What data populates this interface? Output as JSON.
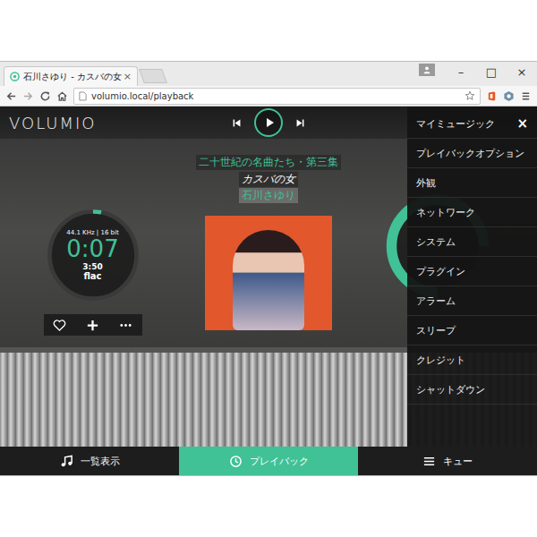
{
  "window": {
    "tab_title": "石川さゆり - カスバの女",
    "tab_close": "×",
    "controls": [
      "–",
      "□",
      "×"
    ]
  },
  "address_bar": {
    "url": "volumio.local/playback"
  },
  "app": {
    "logo": "VOLUMIO"
  },
  "track": {
    "album": "二十世紀の名曲たち・第三集",
    "title": "カスバの女",
    "artist": "石川さゆり",
    "quality": "44.1 KHz | 16 bit",
    "elapsed": "0:07",
    "duration": "3:50",
    "format": "flac",
    "level": 0.03
  },
  "volume": {
    "level": 0.75
  },
  "menu": {
    "close": "×",
    "items": [
      "マイミュージック",
      "プレイバックオプション",
      "外観",
      "ネットワーク",
      "システム",
      "プラグイン",
      "アラーム",
      "スリープ",
      "クレジット",
      "シャットダウン"
    ]
  },
  "bottom_tabs": [
    {
      "label": "一覧表示",
      "selected": false
    },
    {
      "label": "プレイバック",
      "selected": true
    },
    {
      "label": "キュー",
      "selected": false
    }
  ]
}
